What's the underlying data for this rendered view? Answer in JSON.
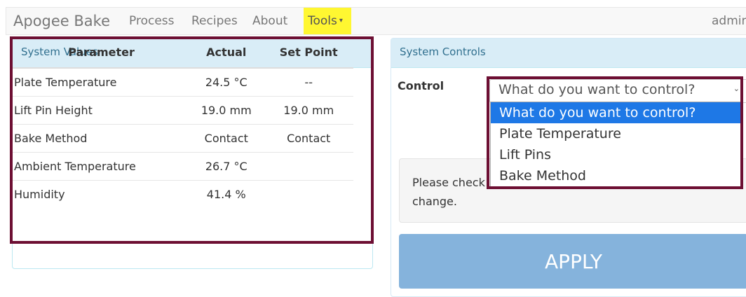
{
  "navbar": {
    "brand": "Apogee Bake",
    "items": [
      "Process",
      "Recipes",
      "About"
    ],
    "tools_label": "Tools",
    "tools_caret": "▾",
    "user": "admin"
  },
  "system_values": {
    "title": "System Values",
    "columns": [
      "Parameter",
      "Actual",
      "Set Point"
    ],
    "rows": [
      {
        "parameter": "Plate Temperature",
        "actual": "24.5 °C",
        "set_point": "--"
      },
      {
        "parameter": "Lift Pin Height",
        "actual": "19.0 mm",
        "set_point": "19.0 mm"
      },
      {
        "parameter": "Bake Method",
        "actual": "Contact",
        "set_point": "Contact"
      },
      {
        "parameter": "Ambient Temperature",
        "actual": "26.7 °C",
        "set_point": ""
      },
      {
        "parameter": "Humidity",
        "actual": "41.4 %",
        "set_point": ""
      }
    ]
  },
  "system_controls": {
    "title": "System Controls",
    "control_label": "Control",
    "select_value": "What do you want to control?",
    "select_arrow": "⌄",
    "options": [
      "What do you want to control?",
      "Plate Temperature",
      "Lift Pins",
      "Bake Method"
    ],
    "selected_index": 0,
    "info_text": "Please check                                   change.",
    "info_line1": "Please check",
    "info_line2": "change.",
    "apply_label": "APPLY"
  },
  "colors": {
    "highlight_border": "#6d0f33",
    "tools_bg": "#fff731",
    "panel_heading_bg": "#d9edf7",
    "apply_bg": "#85b3dc",
    "selected_option_bg": "#1e78e6"
  }
}
